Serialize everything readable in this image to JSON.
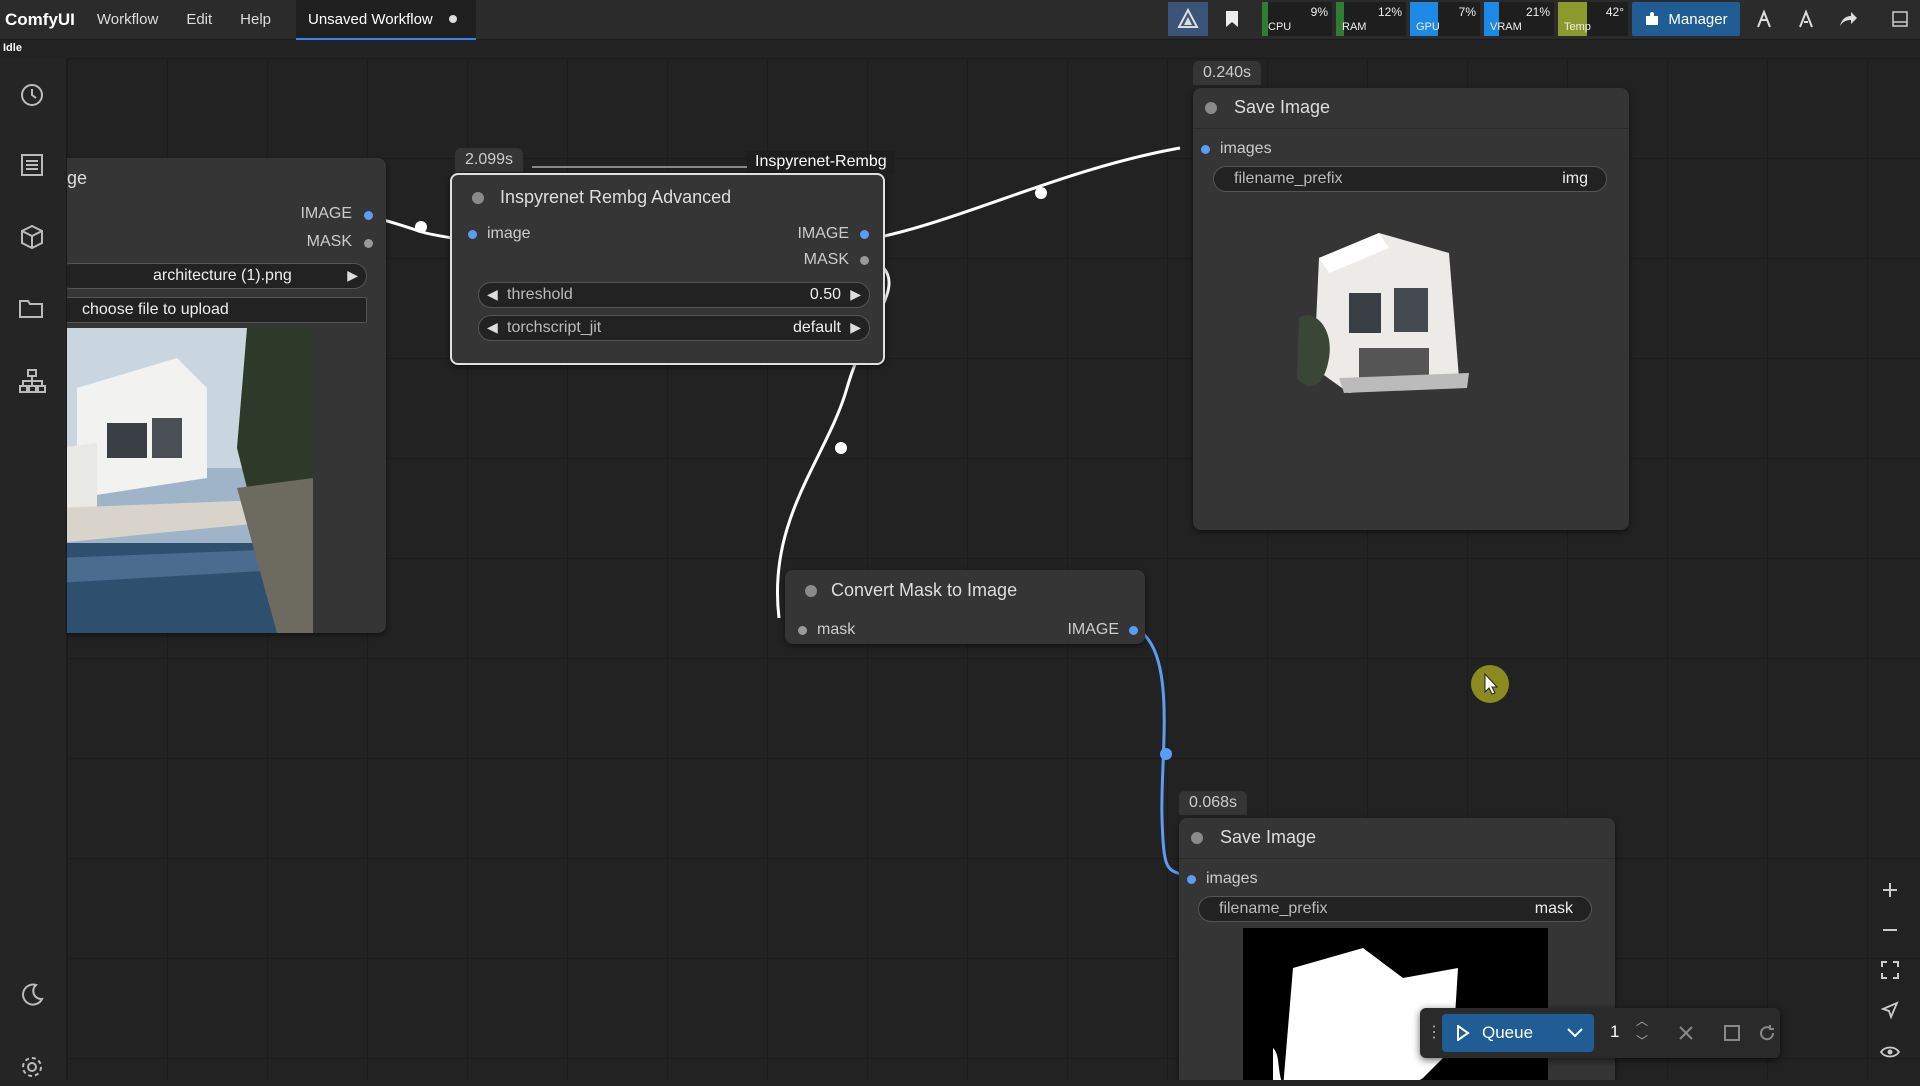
{
  "app": {
    "name": "ComfyUI",
    "status": "Idle"
  },
  "menu": [
    "Workflow",
    "Edit",
    "Help"
  ],
  "workflow_tab": {
    "title": "Unsaved Workflow"
  },
  "stats": [
    {
      "label": "CPU",
      "value": "9%",
      "fill": 0.09,
      "color": "#2e7d32"
    },
    {
      "label": "RAM",
      "value": "12%",
      "fill": 0.12,
      "color": "#2e7d32"
    },
    {
      "label": "GPU",
      "value": "7%",
      "fill": 0.07,
      "color": "#1e88e5"
    },
    {
      "label": "VRAM",
      "value": "21%",
      "fill": 0.21,
      "color": "#1e88e5"
    },
    {
      "label": "Temp",
      "value": "42°",
      "fill": 0.42,
      "color": "#8a9a2e"
    }
  ],
  "manager": {
    "label": "Manager"
  },
  "nodes": {
    "load_image": {
      "title_partial": "ge",
      "outputs": [
        "IMAGE",
        "MASK"
      ],
      "file_value": "architecture (1).png",
      "upload_label": "choose file to upload"
    },
    "rembg": {
      "time": "2.099s",
      "group_label": "Inspyrenet-Rembg",
      "title": "Inspyrenet Rembg Advanced",
      "input": "image",
      "outputs": [
        "IMAGE",
        "MASK"
      ],
      "threshold_label": "threshold",
      "threshold_value": "0.50",
      "jit_label": "torchscript_jit",
      "jit_value": "default"
    },
    "save_image_1": {
      "time": "0.240s",
      "title": "Save Image",
      "input": "images",
      "prefix_label": "filename_prefix",
      "prefix_value": "img"
    },
    "convert_mask": {
      "title": "Convert Mask to Image",
      "input": "mask",
      "output": "IMAGE"
    },
    "save_image_2": {
      "time": "0.068s",
      "title": "Save Image",
      "input": "images",
      "prefix_label": "filename_prefix",
      "prefix_value": "mask"
    }
  },
  "queue": {
    "button_label": "Queue",
    "count": "1"
  },
  "colors": {
    "accent": "#3b82f6",
    "link_white": "#ffffff",
    "link_blue": "#5b9cf5",
    "cursor": "#8a8a1e"
  }
}
